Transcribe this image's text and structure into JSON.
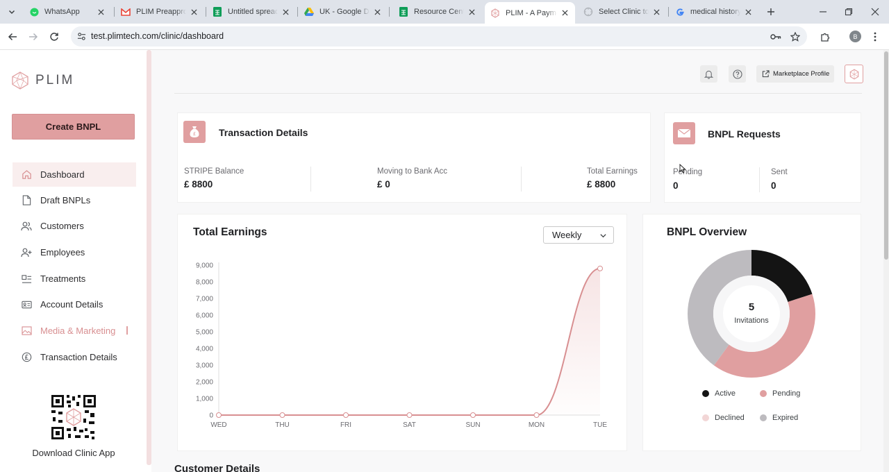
{
  "browser": {
    "tabs": [
      {
        "title": "WhatsApp",
        "favicon": "whatsapp-icon"
      },
      {
        "title": "PLIM Preapproval",
        "favicon": "gmail-icon"
      },
      {
        "title": "Untitled spreadsheet",
        "favicon": "sheets-icon"
      },
      {
        "title": "UK - Google Drive",
        "favicon": "drive-icon"
      },
      {
        "title": "Resource Centre",
        "favicon": "sheets-icon"
      },
      {
        "title": "PLIM - A Payment",
        "favicon": "plim-icon",
        "active": true
      },
      {
        "title": "Select Clinic to c",
        "favicon": "loading-icon"
      },
      {
        "title": "medical history",
        "favicon": "google-icon"
      }
    ],
    "url": "test.plimtech.com/clinic/dashboard",
    "profile_initial": "B"
  },
  "brand": {
    "name": "PLIM",
    "accent": "#e09fa0"
  },
  "sidebar": {
    "create_label": "Create BNPL",
    "items": [
      {
        "label": "Dashboard",
        "icon": "home-icon"
      },
      {
        "label": "Draft BNPLs",
        "icon": "document-icon"
      },
      {
        "label": "Customers",
        "icon": "users-icon"
      },
      {
        "label": "Employees",
        "icon": "user-plus-icon"
      },
      {
        "label": "Treatments",
        "icon": "treatment-icon"
      },
      {
        "label": "Account Details",
        "icon": "id-card-icon"
      },
      {
        "label": "Media & Marketing",
        "icon": "image-icon"
      },
      {
        "label": "Transaction Details",
        "icon": "pound-icon"
      }
    ],
    "download_label": "Download Clinic App"
  },
  "header": {
    "marketplace_label": "Marketplace Profile"
  },
  "transaction_details": {
    "title": "Transaction Details",
    "stats": [
      {
        "label": "STRIPE Balance",
        "value": "£ 8800"
      },
      {
        "label": "Moving to Bank Acc",
        "value": "£ 0"
      },
      {
        "label": "Total Earnings",
        "value": "£ 8800"
      }
    ]
  },
  "bnpl_requests": {
    "title": "BNPL Requests",
    "stats": [
      {
        "label": "Pending",
        "value": "0"
      },
      {
        "label": "Sent",
        "value": "0"
      }
    ]
  },
  "total_earnings": {
    "title": "Total Earnings",
    "period": "Weekly"
  },
  "bnpl_overview": {
    "title": "BNPL Overview",
    "center_value": "5",
    "center_label": "Invitations"
  },
  "customer_details": {
    "title": "Customer Details"
  },
  "chart_data": [
    {
      "type": "area",
      "categories": [
        "WED",
        "THU",
        "FRI",
        "SAT",
        "SUN",
        "MON",
        "TUE"
      ],
      "series": [
        {
          "values": [
            0,
            0,
            0,
            0,
            0,
            0,
            8800
          ],
          "color": "#d88f91"
        }
      ],
      "ylim": [
        0,
        9000
      ],
      "yticks": [
        "0",
        "1,000",
        "2,000",
        "3,000",
        "4,000",
        "5,000",
        "6,000",
        "7,000",
        "8,000",
        "9,000"
      ],
      "title": "Total Earnings",
      "xlabel": "",
      "ylabel": ""
    },
    {
      "type": "pie",
      "hole": true,
      "labels": [
        "Active",
        "Pending",
        "Declined",
        "Expired"
      ],
      "values": [
        1,
        2,
        0,
        2
      ],
      "colors": [
        "#141414",
        "#e09fa0",
        "#f2d6d6",
        "#bdbbbf"
      ],
      "title": "BNPL Overview"
    }
  ]
}
